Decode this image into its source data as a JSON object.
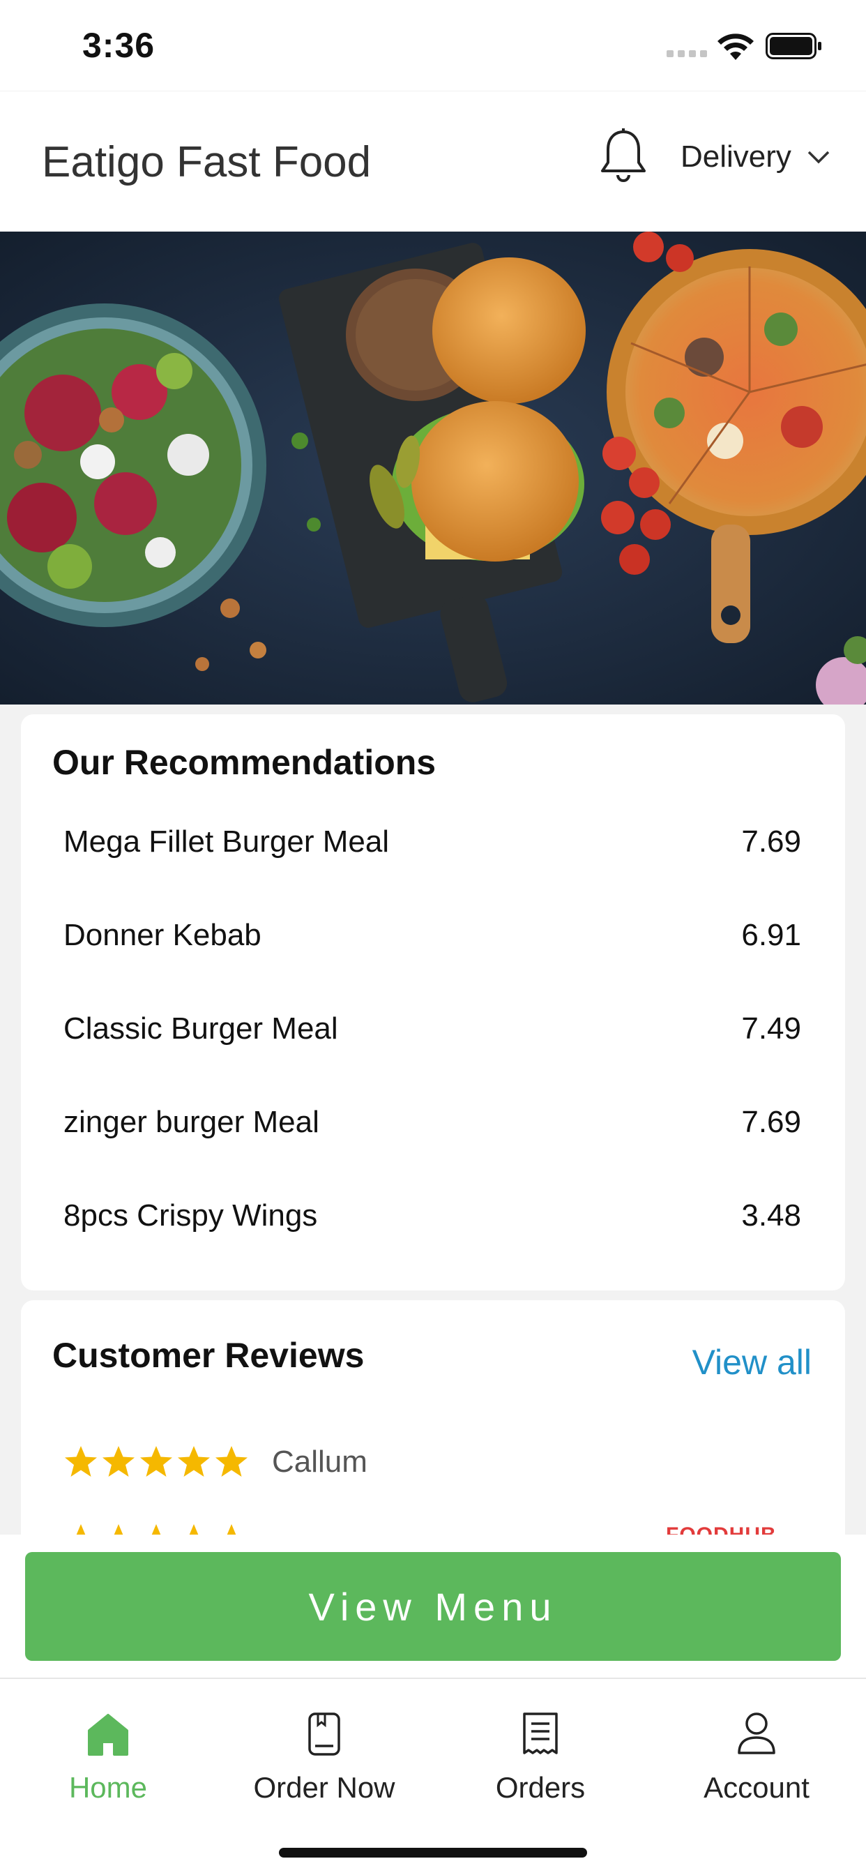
{
  "status_bar": {
    "time": "3:36"
  },
  "header": {
    "title": "Eatigo Fast Food",
    "mode": "Delivery",
    "bell_icon": "bell-icon",
    "chevron_icon": "chevron-down-icon"
  },
  "recommendations": {
    "title": "Our Recommendations",
    "items": [
      {
        "name": "Mega Fillet Burger Meal",
        "price": "7.69"
      },
      {
        "name": "Donner Kebab",
        "price": "6.91"
      },
      {
        "name": "Classic Burger Meal",
        "price": "7.49"
      },
      {
        "name": "zinger burger Meal",
        "price": "7.69"
      },
      {
        "name": "8pcs Crispy Wings",
        "price": "3.48"
      }
    ]
  },
  "reviews": {
    "title": "Customer Reviews",
    "view_all": "View all",
    "items": [
      {
        "name": "Callum",
        "rating": 5
      },
      {
        "name": "",
        "rating": 5,
        "source": "FOODHUB"
      }
    ]
  },
  "view_menu_label": "View Menu",
  "tabs": [
    {
      "label": "Home",
      "icon": "home-icon",
      "active": true
    },
    {
      "label": "Order Now",
      "icon": "order-book-icon",
      "active": false
    },
    {
      "label": "Orders",
      "icon": "receipt-icon",
      "active": false
    },
    {
      "label": "Account",
      "icon": "user-icon",
      "active": false
    }
  ],
  "colors": {
    "accent_green": "#5cb85c",
    "link_blue": "#2190c8",
    "star_gold": "#f5b800",
    "source_red": "#e23b3b"
  }
}
